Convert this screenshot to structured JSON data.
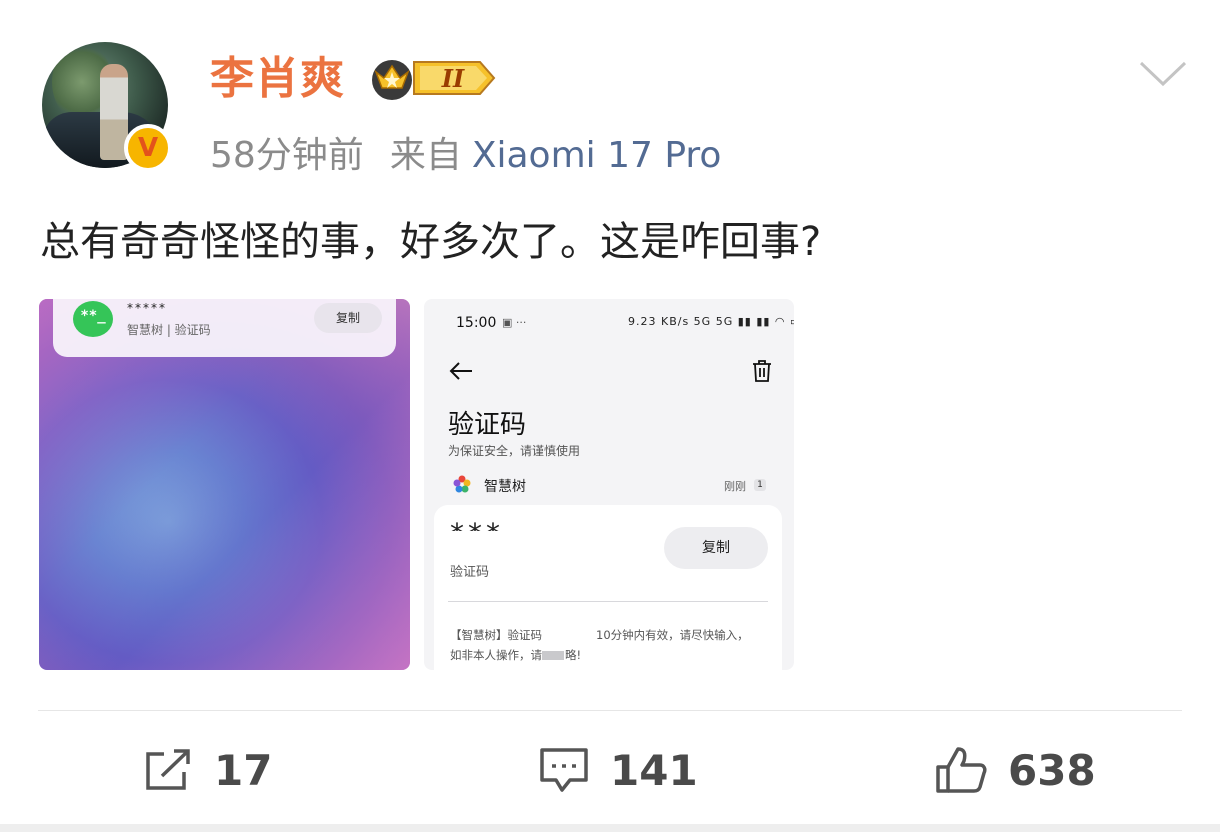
{
  "post": {
    "username": "李肖爽",
    "vip_level": "II",
    "verified_badge": "V",
    "time": "58分钟前",
    "source_label": "来自",
    "device": "Xiaomi 17 Pro",
    "text": "总有奇奇怪怪的事，好多次了。这是咋回事?"
  },
  "image1": {
    "sender": "*****",
    "subtitle": "智慧树 | 验证码",
    "copy_label": "复制"
  },
  "image2": {
    "time": "15:00",
    "status_text": "9.23 KB/s  5G 5G",
    "title": "验证码",
    "subtitle": "为保证安全，请谨慎使用",
    "app_name": "智慧树",
    "received": "刚刚",
    "count": "1",
    "code": "***",
    "code_label": "验证码",
    "copy_label": "复制",
    "message_part1": "【智慧树】验证码",
    "message_part2": "10分钟内有效，请尽快输入，",
    "message_line2_a": "如非本人操作，请",
    "message_line2_b": "略!"
  },
  "actions": {
    "repost_count": "17",
    "comment_count": "141",
    "like_count": "638"
  },
  "colors": {
    "username": "#eb7340",
    "device_link": "#536b93",
    "meta_gray": "#8b8b8b"
  }
}
